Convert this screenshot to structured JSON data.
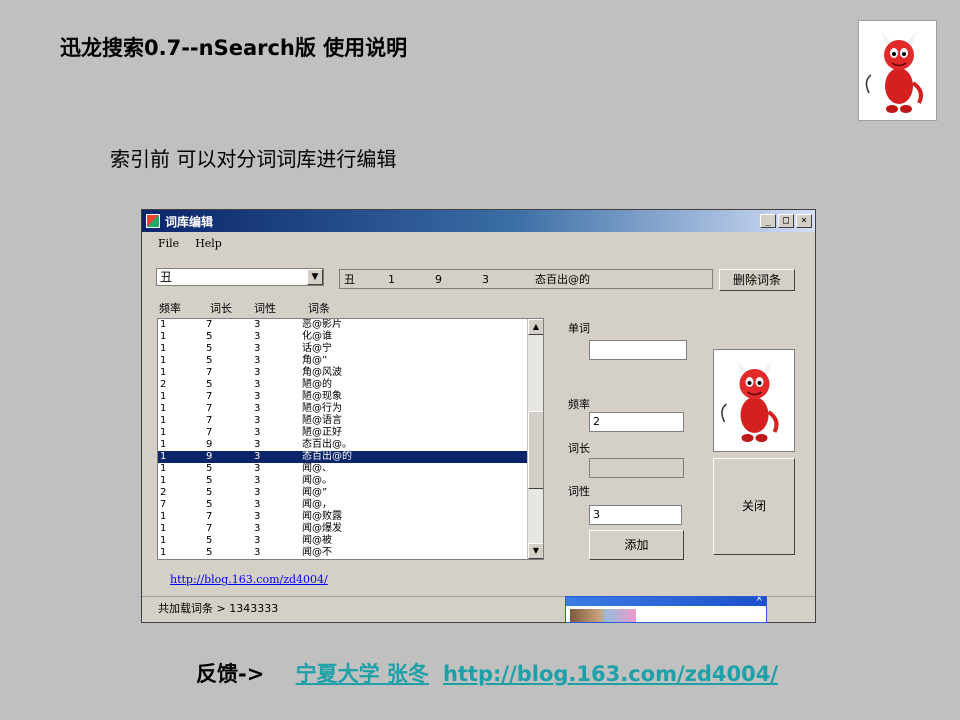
{
  "slide": {
    "title": "迅龙搜索0.7--nSearch版  使用说明",
    "subtitle": "索引前 可以对分词词库进行编辑",
    "footer_label": "反馈->",
    "footer_link_name": "宁夏大学 张冬",
    "footer_link_url": "http://blog.163.com/zd4004/"
  },
  "window": {
    "title": "词库编辑",
    "minimize": "_",
    "maximize": "□",
    "close": "×",
    "menu": [
      "File",
      "Help"
    ],
    "combo_value": "丑",
    "detail": {
      "word": "丑",
      "freq": "1",
      "len": "9",
      "pos": "3",
      "entry": "态百出@的"
    },
    "delete_button": "删除词条",
    "columns": [
      "频率",
      "词长",
      "词性",
      "词条"
    ],
    "rows": [
      [
        "1",
        "7",
        "3",
        "恶@影片"
      ],
      [
        "1",
        "5",
        "3",
        "化@谁"
      ],
      [
        "1",
        "5",
        "3",
        "话@宁"
      ],
      [
        "1",
        "5",
        "3",
        "角@”"
      ],
      [
        "1",
        "7",
        "3",
        "角@风波"
      ],
      [
        "2",
        "5",
        "3",
        "陋@的"
      ],
      [
        "1",
        "7",
        "3",
        "陋@现象"
      ],
      [
        "1",
        "7",
        "3",
        "陋@行为"
      ],
      [
        "1",
        "7",
        "3",
        "陋@语言"
      ],
      [
        "1",
        "7",
        "3",
        "陋@正好"
      ],
      [
        "1",
        "9",
        "3",
        "态百出@。"
      ],
      [
        "1",
        "9",
        "3",
        "态百出@的"
      ],
      [
        "1",
        "5",
        "3",
        "闻@、"
      ],
      [
        "1",
        "5",
        "3",
        "闻@。"
      ],
      [
        "2",
        "5",
        "3",
        "闻@”"
      ],
      [
        "7",
        "5",
        "3",
        "闻@，"
      ],
      [
        "1",
        "7",
        "3",
        "闻@败露"
      ],
      [
        "1",
        "7",
        "3",
        "闻@爆发"
      ],
      [
        "1",
        "5",
        "3",
        "闻@被"
      ],
      [
        "1",
        "5",
        "3",
        "闻@不"
      ]
    ],
    "selected_row_index": 11,
    "labels": {
      "word": "单词",
      "freq": "频率",
      "len": "词长",
      "pos": "词性"
    },
    "fields": {
      "word": "",
      "freq": "2",
      "len": "",
      "pos": "3"
    },
    "add_button": "添加",
    "close_button": "关闭",
    "link": "http://blog.163.com/zd4004/",
    "status": "共加载词条 > 1343333"
  },
  "popup": {
    "close": "×"
  }
}
